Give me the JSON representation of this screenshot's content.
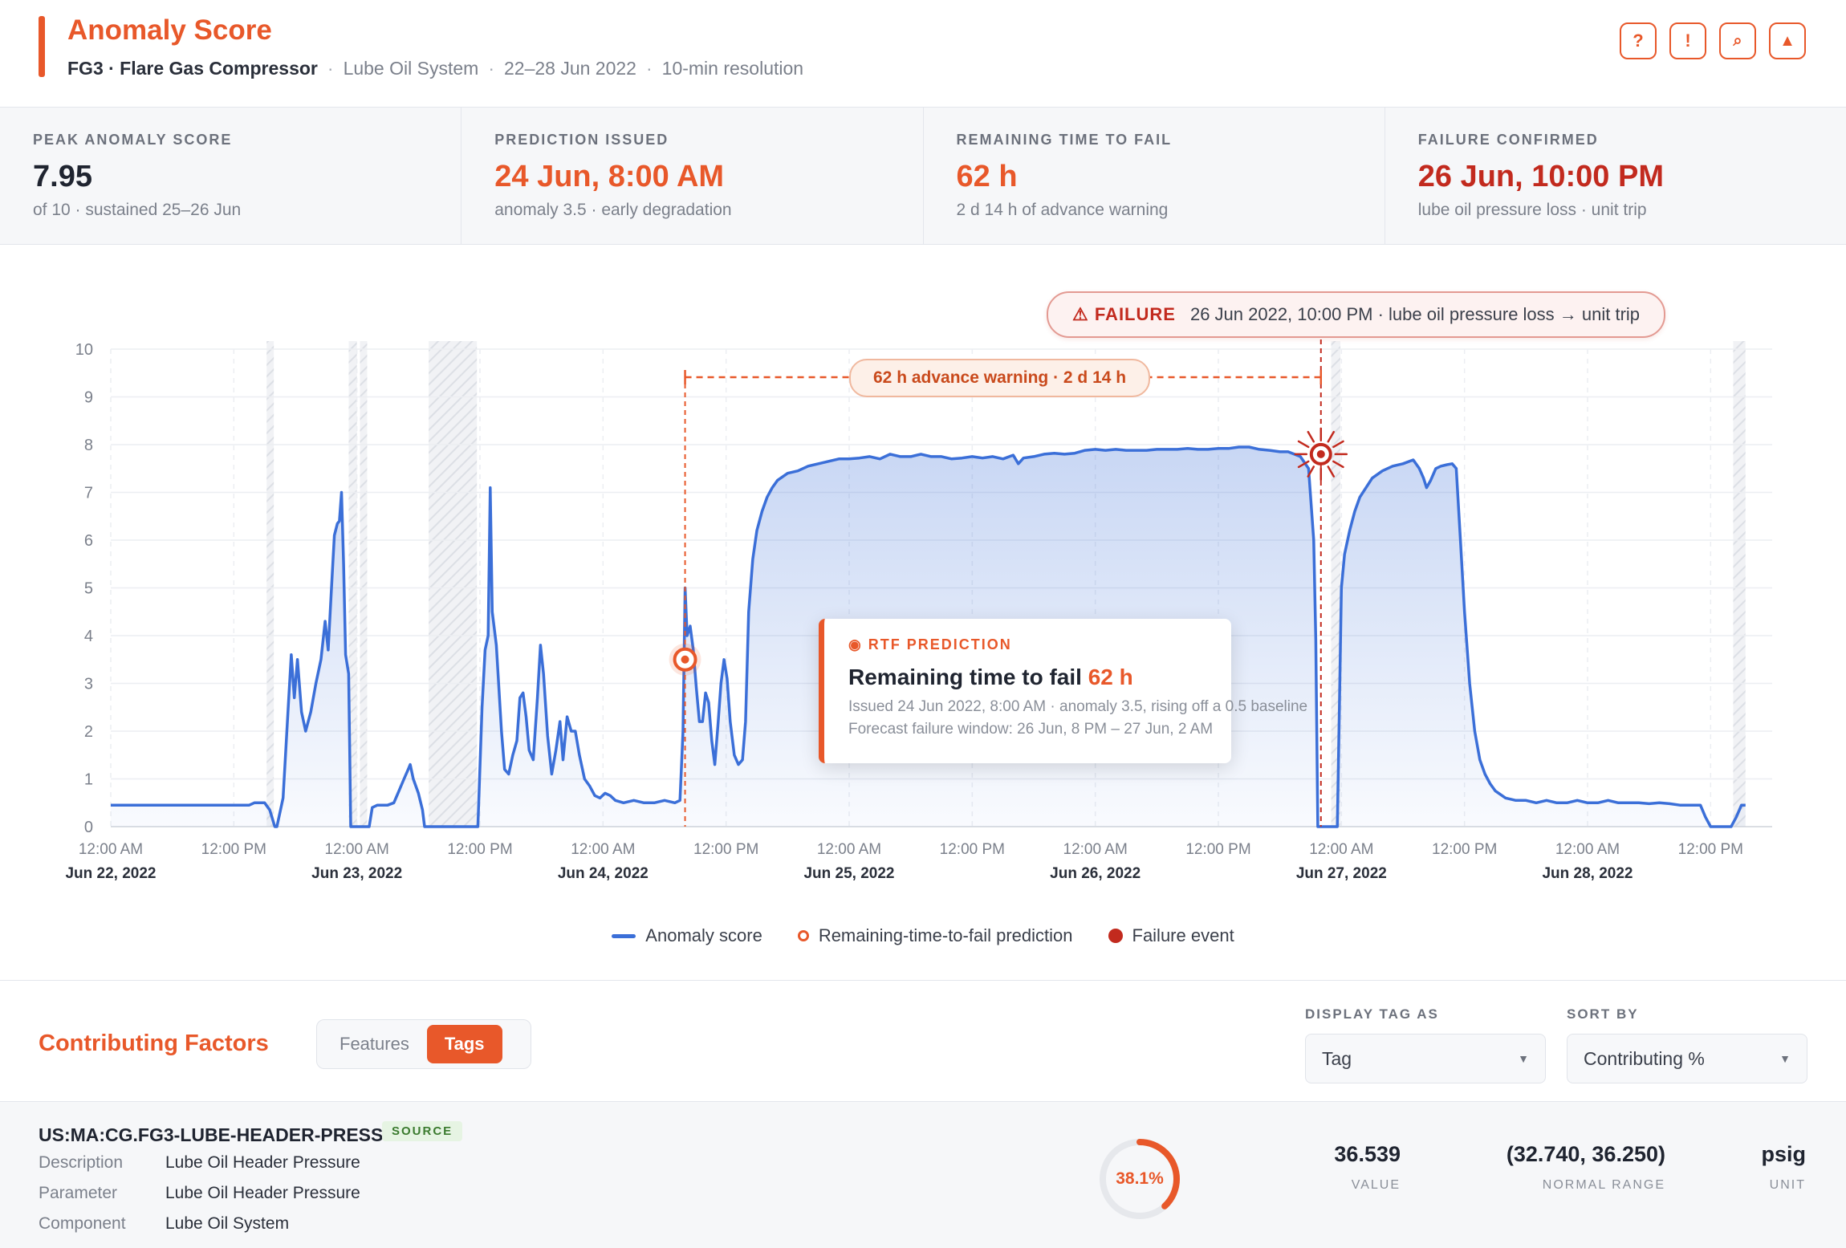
{
  "header": {
    "title": "Anomaly Score",
    "asset": "FG3 · Flare Gas Compressor",
    "system": "Lube Oil System",
    "date_range": "22–28 Jun 2022",
    "resolution": "10-min resolution",
    "buttons": [
      {
        "icon": "help-icon",
        "glyph": "?"
      },
      {
        "icon": "alert-icon",
        "glyph": "!"
      },
      {
        "icon": "search-icon",
        "glyph": "⌕"
      },
      {
        "icon": "warning-triangle-icon",
        "glyph": "▲"
      }
    ]
  },
  "kpis": [
    {
      "label": "PEAK ANOMALY SCORE",
      "value": "7.95",
      "sub": "of 10 · sustained 25–26 Jun",
      "tone": "dark"
    },
    {
      "label": "PREDICTION ISSUED",
      "value": "24 Jun, 8:00 AM",
      "sub": "anomaly 3.5 · early degradation",
      "tone": "orange"
    },
    {
      "label": "REMAINING TIME TO FAIL",
      "value": "62 h",
      "sub": "2 d 14 h of advance warning",
      "tone": "orange"
    },
    {
      "label": "FAILURE CONFIRMED",
      "value": "26 Jun, 10:00 PM",
      "sub": "lube oil pressure loss · unit trip",
      "tone": "red"
    }
  ],
  "annotations": {
    "failure_tag": "⚠ FAILURE",
    "failure_text": "26 Jun 2022, 10:00 PM · lube oil pressure loss → unit trip",
    "warning_text": "62 h advance warning · 2 d 14 h"
  },
  "tooltip": {
    "tag": "◉ RTF PREDICTION",
    "title": "Remaining time to fail",
    "value": "62 h",
    "line1": "Issued 24 Jun 2022, 8:00 AM · anomaly 3.5, rising off a 0.5 baseline",
    "line2": "Forecast failure window: 26 Jun, 8 PM – 27 Jun, 2 AM"
  },
  "legend": {
    "anomaly": "Anomaly score",
    "prediction": "Remaining-time-to-fail prediction",
    "failure": "Failure event"
  },
  "colors": {
    "accent": "#e8582a",
    "failure": "#c22a1e",
    "series": "#3b6fd8"
  },
  "chart_data": {
    "type": "area",
    "x_unit": "hours since 22 Jun 2022 12:00 AM",
    "x_range_hours": [
      0,
      162
    ],
    "ylim": [
      0,
      10
    ],
    "yticks": [
      0,
      1,
      2,
      3,
      4,
      5,
      6,
      7,
      8,
      9,
      10
    ],
    "xticks": [
      {
        "h": 0,
        "time": "12:00 AM",
        "date": "Jun 22, 2022"
      },
      {
        "h": 12,
        "time": "12:00 PM",
        "date": ""
      },
      {
        "h": 24,
        "time": "12:00 AM",
        "date": "Jun 23, 2022"
      },
      {
        "h": 36,
        "time": "12:00 PM",
        "date": ""
      },
      {
        "h": 48,
        "time": "12:00 AM",
        "date": "Jun 24, 2022"
      },
      {
        "h": 60,
        "time": "12:00 PM",
        "date": ""
      },
      {
        "h": 72,
        "time": "12:00 AM",
        "date": "Jun 25, 2022"
      },
      {
        "h": 84,
        "time": "12:00 PM",
        "date": ""
      },
      {
        "h": 96,
        "time": "12:00 AM",
        "date": "Jun 26, 2022"
      },
      {
        "h": 108,
        "time": "12:00 PM",
        "date": ""
      },
      {
        "h": 120,
        "time": "12:00 AM",
        "date": "Jun 27, 2022"
      },
      {
        "h": 132,
        "time": "12:00 PM",
        "date": ""
      },
      {
        "h": 144,
        "time": "12:00 AM",
        "date": "Jun 28, 2022"
      },
      {
        "h": 156,
        "time": "12:00 PM",
        "date": ""
      }
    ],
    "series": [
      {
        "name": "Anomaly score",
        "points": [
          [
            0,
            0.45
          ],
          [
            13.5,
            0.45
          ],
          [
            14,
            0.5
          ],
          [
            15,
            0.5
          ],
          [
            15.5,
            0.35
          ],
          [
            16,
            0
          ],
          [
            16.2,
            0
          ],
          [
            16.8,
            0.6
          ],
          [
            17.3,
            2.5
          ],
          [
            17.6,
            3.6
          ],
          [
            17.9,
            2.7
          ],
          [
            18.2,
            3.5
          ],
          [
            18.6,
            2.4
          ],
          [
            19,
            2.0
          ],
          [
            19.5,
            2.4
          ],
          [
            20,
            3.0
          ],
          [
            20.5,
            3.5
          ],
          [
            20.9,
            4.3
          ],
          [
            21.2,
            3.7
          ],
          [
            21.5,
            4.9
          ],
          [
            21.8,
            6.1
          ],
          [
            22.1,
            6.35
          ],
          [
            22.3,
            6.4
          ],
          [
            22.5,
            7.0
          ],
          [
            22.7,
            5.5
          ],
          [
            22.9,
            3.6
          ],
          [
            23.2,
            3.2
          ],
          [
            23.4,
            0
          ],
          [
            24.5,
            0
          ],
          [
            25.2,
            0
          ],
          [
            25.5,
            0.4
          ],
          [
            26,
            0.45
          ],
          [
            27,
            0.45
          ],
          [
            27.6,
            0.5
          ],
          [
            28,
            0.7
          ],
          [
            28.6,
            1.0
          ],
          [
            29,
            1.2
          ],
          [
            29.2,
            1.3
          ],
          [
            29.5,
            1.0
          ],
          [
            30,
            0.7
          ],
          [
            30.4,
            0.35
          ],
          [
            30.6,
            0
          ],
          [
            31,
            0
          ],
          [
            33,
            0
          ],
          [
            35.8,
            0
          ],
          [
            36.2,
            2.5
          ],
          [
            36.5,
            3.7
          ],
          [
            36.8,
            4.0
          ],
          [
            37,
            7.1
          ],
          [
            37.2,
            4.5
          ],
          [
            37.6,
            3.8
          ],
          [
            38.1,
            2.0
          ],
          [
            38.4,
            1.2
          ],
          [
            38.8,
            1.1
          ],
          [
            39.2,
            1.5
          ],
          [
            39.6,
            1.8
          ],
          [
            39.9,
            2.7
          ],
          [
            40.2,
            2.8
          ],
          [
            40.5,
            2.3
          ],
          [
            40.8,
            1.6
          ],
          [
            41.2,
            1.4
          ],
          [
            41.6,
            2.7
          ],
          [
            41.9,
            3.8
          ],
          [
            42.2,
            3.2
          ],
          [
            42.6,
            1.9
          ],
          [
            43,
            1.1
          ],
          [
            43.4,
            1.6
          ],
          [
            43.8,
            2.2
          ],
          [
            44.1,
            1.4
          ],
          [
            44.5,
            2.3
          ],
          [
            44.9,
            2.0
          ],
          [
            45.3,
            2.0
          ],
          [
            45.7,
            1.5
          ],
          [
            46.2,
            1.0
          ],
          [
            46.7,
            0.85
          ],
          [
            47.2,
            0.65
          ],
          [
            47.7,
            0.6
          ],
          [
            48.2,
            0.7
          ],
          [
            48.7,
            0.65
          ],
          [
            49.2,
            0.55
          ],
          [
            50,
            0.5
          ],
          [
            51,
            0.55
          ],
          [
            52,
            0.5
          ],
          [
            53,
            0.5
          ],
          [
            54,
            0.55
          ],
          [
            55,
            0.5
          ],
          [
            55.5,
            0.55
          ],
          [
            55.8,
            2.0
          ],
          [
            56,
            5.0
          ],
          [
            56.2,
            4.0
          ],
          [
            56.5,
            4.2
          ],
          [
            56.8,
            3.7
          ],
          [
            57.1,
            2.9
          ],
          [
            57.4,
            2.2
          ],
          [
            57.7,
            2.2
          ],
          [
            58,
            2.8
          ],
          [
            58.3,
            2.6
          ],
          [
            58.6,
            1.8
          ],
          [
            58.9,
            1.3
          ],
          [
            59.2,
            2.1
          ],
          [
            59.5,
            3.0
          ],
          [
            59.8,
            3.5
          ],
          [
            60.1,
            3.1
          ],
          [
            60.4,
            2.2
          ],
          [
            60.8,
            1.5
          ],
          [
            61.2,
            1.3
          ],
          [
            61.6,
            1.4
          ],
          [
            61.9,
            2.2
          ],
          [
            62.2,
            4.5
          ],
          [
            62.6,
            5.6
          ],
          [
            63,
            6.2
          ],
          [
            63.5,
            6.6
          ],
          [
            64,
            6.9
          ],
          [
            64.5,
            7.1
          ],
          [
            65,
            7.25
          ],
          [
            66,
            7.4
          ],
          [
            67,
            7.45
          ],
          [
            68,
            7.55
          ],
          [
            69,
            7.6
          ],
          [
            70,
            7.65
          ],
          [
            71,
            7.7
          ],
          [
            72,
            7.7
          ],
          [
            73,
            7.72
          ],
          [
            74,
            7.75
          ],
          [
            75,
            7.7
          ],
          [
            76,
            7.8
          ],
          [
            77,
            7.75
          ],
          [
            78,
            7.75
          ],
          [
            79,
            7.8
          ],
          [
            80,
            7.75
          ],
          [
            81,
            7.75
          ],
          [
            82,
            7.7
          ],
          [
            83,
            7.72
          ],
          [
            84,
            7.75
          ],
          [
            85,
            7.72
          ],
          [
            86,
            7.75
          ],
          [
            87,
            7.7
          ],
          [
            88,
            7.78
          ],
          [
            88.5,
            7.6
          ],
          [
            89,
            7.72
          ],
          [
            90,
            7.75
          ],
          [
            91,
            7.8
          ],
          [
            92,
            7.82
          ],
          [
            93,
            7.8
          ],
          [
            94,
            7.82
          ],
          [
            95,
            7.88
          ],
          [
            96,
            7.9
          ],
          [
            97,
            7.88
          ],
          [
            98,
            7.9
          ],
          [
            99,
            7.88
          ],
          [
            100,
            7.88
          ],
          [
            101,
            7.88
          ],
          [
            102,
            7.9
          ],
          [
            103,
            7.9
          ],
          [
            104,
            7.9
          ],
          [
            105,
            7.92
          ],
          [
            106,
            7.9
          ],
          [
            107,
            7.9
          ],
          [
            108,
            7.92
          ],
          [
            109,
            7.92
          ],
          [
            110,
            7.95
          ],
          [
            111,
            7.95
          ],
          [
            112,
            7.9
          ],
          [
            113,
            7.88
          ],
          [
            114,
            7.85
          ],
          [
            114.8,
            7.85
          ],
          [
            115.4,
            7.8
          ],
          [
            116,
            7.75
          ],
          [
            116.8,
            7.5
          ],
          [
            117.3,
            6.0
          ],
          [
            117.5,
            3.9
          ],
          [
            117.7,
            0
          ],
          [
            118,
            0
          ],
          [
            119,
            0
          ],
          [
            119.6,
            0
          ],
          [
            119.8,
            2.5
          ],
          [
            120,
            5.0
          ],
          [
            120.3,
            5.7
          ],
          [
            120.8,
            6.2
          ],
          [
            121.3,
            6.6
          ],
          [
            121.8,
            6.9
          ],
          [
            122.4,
            7.1
          ],
          [
            123,
            7.3
          ],
          [
            124,
            7.45
          ],
          [
            125,
            7.55
          ],
          [
            126,
            7.6
          ],
          [
            127,
            7.68
          ],
          [
            127.6,
            7.5
          ],
          [
            128,
            7.3
          ],
          [
            128.3,
            7.1
          ],
          [
            128.7,
            7.25
          ],
          [
            129.2,
            7.5
          ],
          [
            129.7,
            7.55
          ],
          [
            130.3,
            7.58
          ],
          [
            130.8,
            7.6
          ],
          [
            131.2,
            7.5
          ],
          [
            131.6,
            6.0
          ],
          [
            132,
            4.5
          ],
          [
            132.5,
            3.0
          ],
          [
            133,
            2.0
          ],
          [
            133.5,
            1.4
          ],
          [
            134,
            1.1
          ],
          [
            134.5,
            0.9
          ],
          [
            135,
            0.75
          ],
          [
            136,
            0.6
          ],
          [
            137,
            0.55
          ],
          [
            138,
            0.55
          ],
          [
            139,
            0.5
          ],
          [
            140,
            0.55
          ],
          [
            141,
            0.5
          ],
          [
            142,
            0.5
          ],
          [
            143,
            0.55
          ],
          [
            144,
            0.5
          ],
          [
            145,
            0.5
          ],
          [
            146,
            0.55
          ],
          [
            147,
            0.5
          ],
          [
            148,
            0.5
          ],
          [
            149,
            0.5
          ],
          [
            150,
            0.48
          ],
          [
            151,
            0.5
          ],
          [
            152,
            0.48
          ],
          [
            153,
            0.45
          ],
          [
            154,
            0.45
          ],
          [
            155,
            0.45
          ],
          [
            155.5,
            0.2
          ],
          [
            156,
            0
          ],
          [
            157,
            0
          ],
          [
            158,
            0
          ],
          [
            158.5,
            0.2
          ],
          [
            159,
            0.45
          ],
          [
            159.4,
            0.45
          ]
        ]
      }
    ],
    "gap_bands_hours": [
      [
        15.2,
        15.9
      ],
      [
        23.2,
        24.0
      ],
      [
        24.3,
        25.0
      ],
      [
        31.0,
        35.7
      ],
      [
        119.0,
        119.9
      ],
      [
        158.2,
        159.4
      ]
    ],
    "prediction_hour": 56,
    "prediction_value": 3.5,
    "failure_hour": 118,
    "failure_value": 7.8,
    "warning_span_hours": 62
  },
  "contributing": {
    "title": "Contributing Factors",
    "tabs": [
      "Features",
      "Tags"
    ],
    "active_tab": "Tags",
    "display_label": "DISPLAY TAG AS",
    "display_value": "Tag",
    "sort_label": "SORT BY",
    "sort_value": "Contributing %"
  },
  "tag": {
    "name": "US:MA:CG.FG3-LUBE-HEADER-PRESS",
    "badge": "SOURCE",
    "description_label": "Description",
    "description": "Lube Oil Header Pressure",
    "parameter_label": "Parameter",
    "parameter": "Lube Oil Header Pressure",
    "component_label": "Component",
    "component": "Lube Oil System",
    "contribution_pct": 38.1,
    "contribution_text": "38.1%",
    "value": "36.539",
    "value_label": "VALUE",
    "normal_range": "(32.740, 36.250)",
    "normal_range_label": "NORMAL RANGE",
    "unit": "psig",
    "unit_label": "UNIT"
  }
}
